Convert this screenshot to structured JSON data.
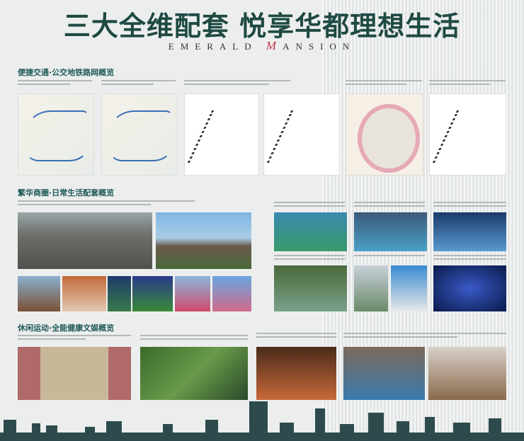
{
  "header": {
    "title": "三大全维配套 悦享华都理想生活",
    "brand_prefix": "EMERALD ",
    "brand_m": "M",
    "brand_suffix": "ANSION"
  },
  "sections": [
    {
      "title": "便捷交通·公交地铁路网概览"
    },
    {
      "title": "繁华商圈·日常生活配套概览"
    },
    {
      "title": "休闲运动·全能健康文娱概览"
    }
  ],
  "colors": {
    "title": "#1f4a44",
    "section": "#1f5a55",
    "accent": "#c0394b",
    "skyline": "#2d4b4d"
  }
}
